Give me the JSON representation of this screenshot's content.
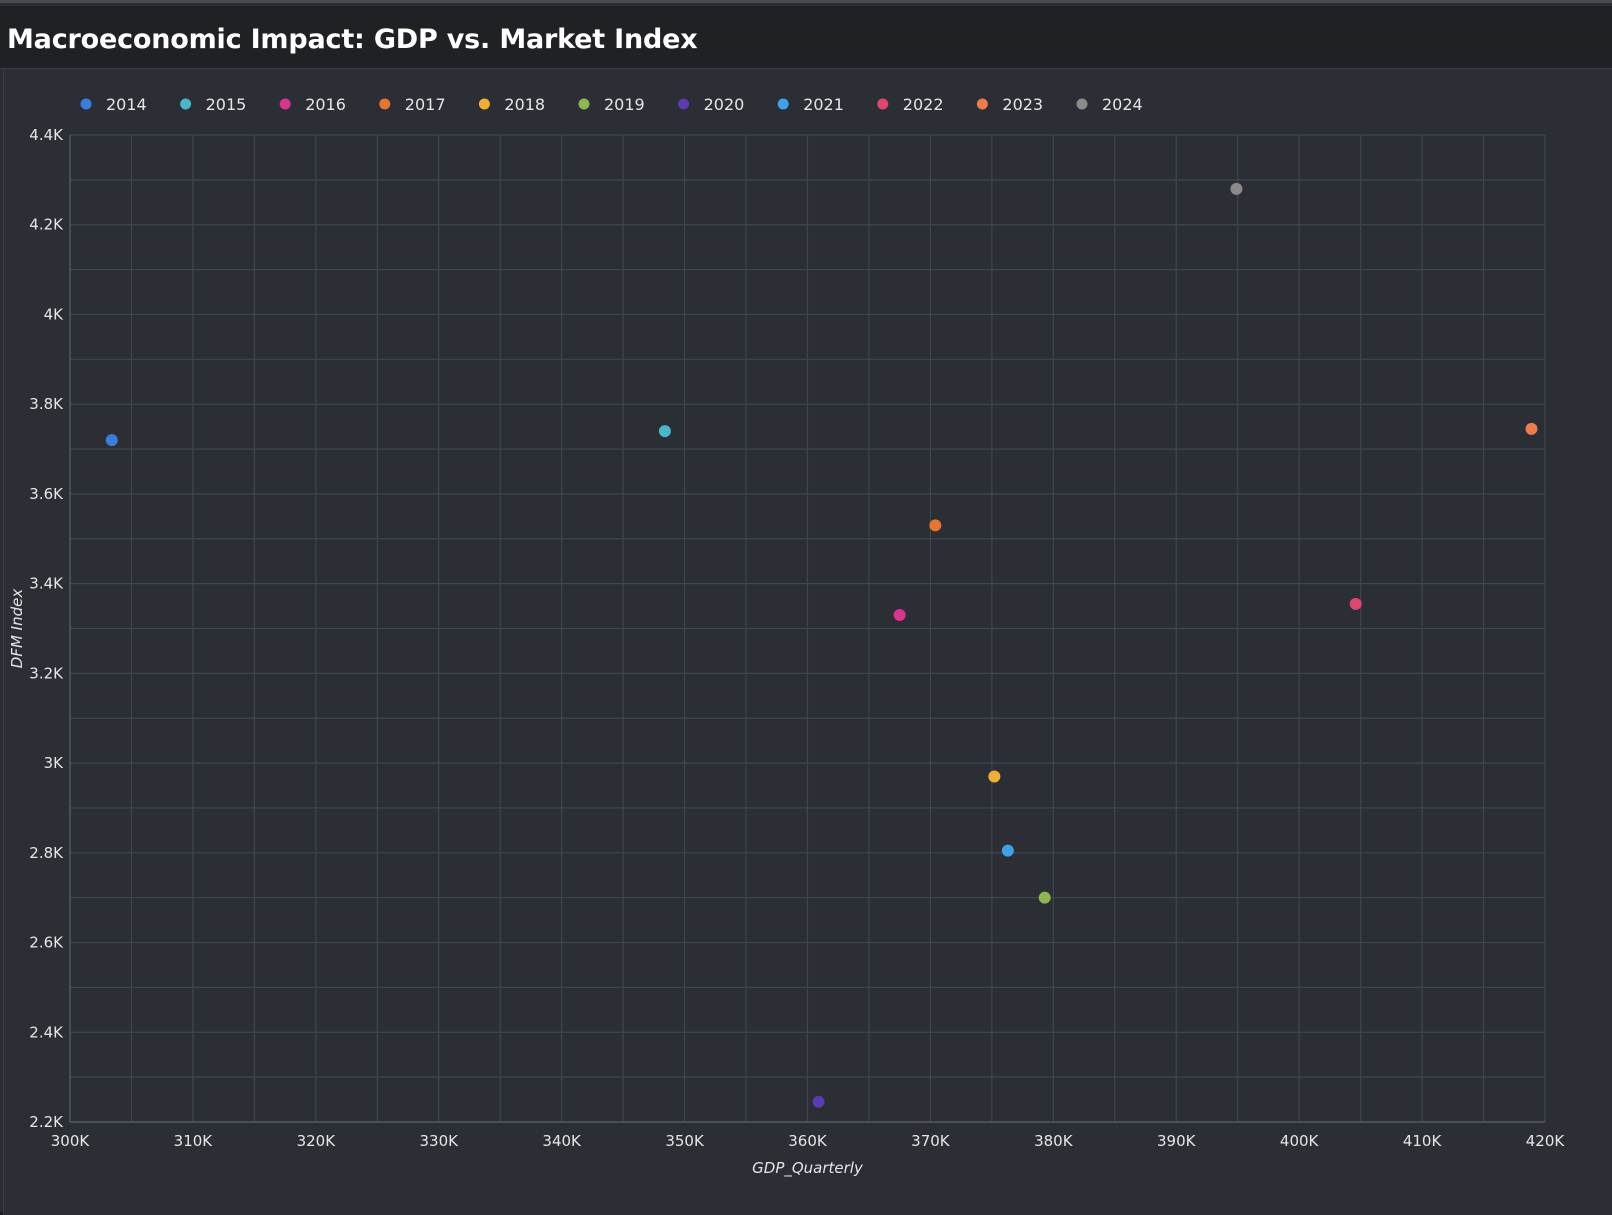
{
  "header": {
    "title": "Macroeconomic Impact: GDP vs. Market Index"
  },
  "chart_data": {
    "type": "scatter",
    "title": "Macroeconomic Impact: GDP vs. Market Index",
    "xlabel": "GDP_Quarterly",
    "ylabel": "DFM Index",
    "xlim": [
      300000,
      420000
    ],
    "ylim": [
      2200,
      4400
    ],
    "x_ticks": [
      300000,
      310000,
      320000,
      330000,
      340000,
      350000,
      360000,
      370000,
      380000,
      390000,
      400000,
      410000,
      420000
    ],
    "x_tick_labels": [
      "300K",
      "310K",
      "320K",
      "330K",
      "340K",
      "350K",
      "360K",
      "370K",
      "380K",
      "390K",
      "400K",
      "410K",
      "420K"
    ],
    "y_ticks": [
      2200,
      2400,
      2600,
      2800,
      3000,
      3200,
      3400,
      3600,
      3800,
      4000,
      4200,
      4400
    ],
    "y_tick_labels": [
      "2.2K",
      "2.4K",
      "2.6K",
      "2.8K",
      "3K",
      "3.2K",
      "3.4K",
      "3.6K",
      "3.8K",
      "4K",
      "4.2K",
      "4.4K"
    ],
    "grid": true,
    "legend_position": "top-left",
    "series": [
      {
        "name": "2014",
        "color": "#3b7ddd",
        "points": [
          {
            "x": 303400,
            "y": 3720
          }
        ]
      },
      {
        "name": "2015",
        "color": "#49b6c9",
        "points": [
          {
            "x": 348400,
            "y": 3740
          }
        ]
      },
      {
        "name": "2016",
        "color": "#d8358f",
        "points": [
          {
            "x": 367500,
            "y": 3330
          }
        ]
      },
      {
        "name": "2017",
        "color": "#e6762f",
        "points": [
          {
            "x": 370400,
            "y": 3530
          }
        ]
      },
      {
        "name": "2018",
        "color": "#f2ae34",
        "points": [
          {
            "x": 375200,
            "y": 2970
          }
        ]
      },
      {
        "name": "2019",
        "color": "#8db84f",
        "points": [
          {
            "x": 379300,
            "y": 2700
          }
        ]
      },
      {
        "name": "2020",
        "color": "#5a3bb0",
        "points": [
          {
            "x": 360900,
            "y": 2245
          }
        ]
      },
      {
        "name": "2021",
        "color": "#3ea0e6",
        "points": [
          {
            "x": 376300,
            "y": 2805
          }
        ]
      },
      {
        "name": "2022",
        "color": "#e0466e",
        "points": [
          {
            "x": 404600,
            "y": 3355
          }
        ]
      },
      {
        "name": "2023",
        "color": "#ef7b4d",
        "points": [
          {
            "x": 418900,
            "y": 3745
          }
        ]
      },
      {
        "name": "2024",
        "color": "#8b8b8b",
        "points": [
          {
            "x": 394900,
            "y": 4280
          }
        ]
      }
    ]
  }
}
